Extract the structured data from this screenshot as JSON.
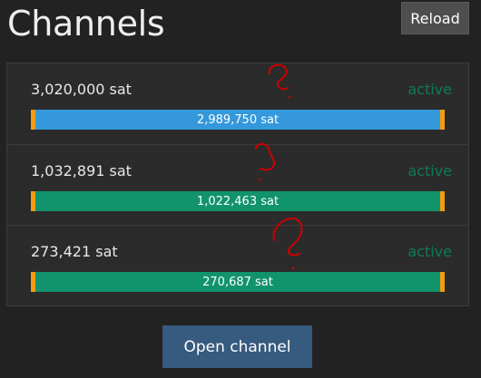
{
  "header": {
    "title": "Channels",
    "reload_label": "Reload"
  },
  "channels": [
    {
      "capacity": "3,020,000 sat",
      "status": "active",
      "balance": "2,989,750 sat",
      "bar_color": "#3498db",
      "endpoint_color": "#f39c12"
    },
    {
      "capacity": "1,032,891 sat",
      "status": "active",
      "balance": "1,022,463 sat",
      "bar_color": "#11936c",
      "endpoint_color": "#f39c12"
    },
    {
      "capacity": "273,421 sat",
      "status": "active",
      "balance": "270,687 sat",
      "bar_color": "#11936c",
      "endpoint_color": "#f39c12"
    }
  ],
  "footer": {
    "open_channel_label": "Open channel"
  },
  "colors": {
    "background": "#222222",
    "panel": "#2b2b2b",
    "status_active": "#0f7a5a",
    "primary_button": "#375a7f",
    "annotation": "#cc0000"
  },
  "annotations": [
    "question-mark",
    "question-mark",
    "question-mark"
  ]
}
